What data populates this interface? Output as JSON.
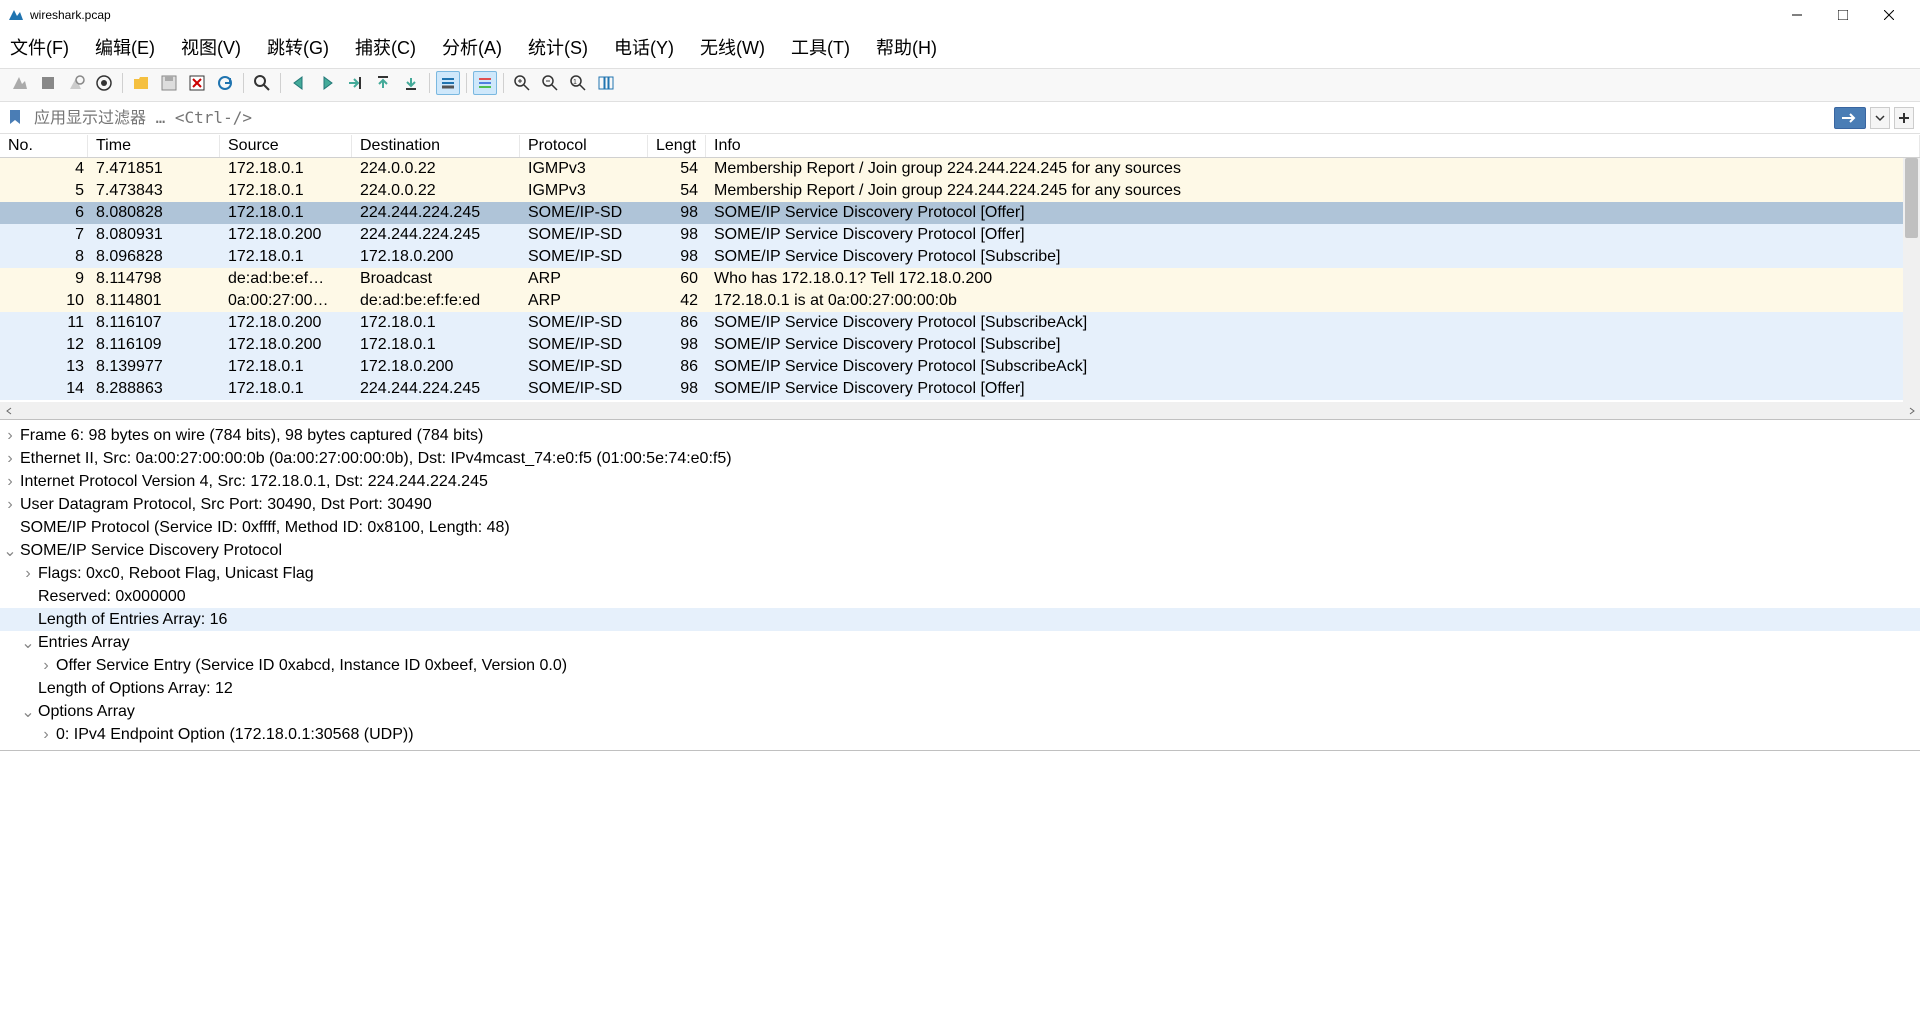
{
  "title": "wireshark.pcap",
  "menu": [
    "文件(F)",
    "编辑(E)",
    "视图(V)",
    "跳转(G)",
    "捕获(C)",
    "分析(A)",
    "统计(S)",
    "电话(Y)",
    "无线(W)",
    "工具(T)",
    "帮助(H)"
  ],
  "filter_placeholder": "应用显示过滤器 … <Ctrl-/>",
  "columns": [
    "No.",
    "Time",
    "Source",
    "Destination",
    "Protocol",
    "Lengt",
    "Info"
  ],
  "packets": [
    {
      "no": "4",
      "time": "7.471851",
      "src": "172.18.0.1",
      "dst": "224.0.0.22",
      "proto": "IGMPv3",
      "len": "54",
      "info": "Membership Report / Join group 224.244.224.245 for any sources",
      "cls": "bg-yellow"
    },
    {
      "no": "5",
      "time": "7.473843",
      "src": "172.18.0.1",
      "dst": "224.0.0.22",
      "proto": "IGMPv3",
      "len": "54",
      "info": "Membership Report / Join group 224.244.224.245 for any sources",
      "cls": "bg-yellow"
    },
    {
      "no": "6",
      "time": "8.080828",
      "src": "172.18.0.1",
      "dst": "224.244.224.245",
      "proto": "SOME/IP-SD",
      "len": "98",
      "info": "SOME/IP Service Discovery Protocol [Offer]",
      "cls": "bg-selected"
    },
    {
      "no": "7",
      "time": "8.080931",
      "src": "172.18.0.200",
      "dst": "224.244.224.245",
      "proto": "SOME/IP-SD",
      "len": "98",
      "info": "SOME/IP Service Discovery Protocol [Offer]",
      "cls": "bg-blue"
    },
    {
      "no": "8",
      "time": "8.096828",
      "src": "172.18.0.1",
      "dst": "172.18.0.200",
      "proto": "SOME/IP-SD",
      "len": "98",
      "info": "SOME/IP Service Discovery Protocol [Subscribe]",
      "cls": "bg-blue"
    },
    {
      "no": "9",
      "time": "8.114798",
      "src": "de:ad:be:ef…",
      "dst": "Broadcast",
      "proto": "ARP",
      "len": "60",
      "info": "Who has 172.18.0.1? Tell 172.18.0.200",
      "cls": "bg-yellow"
    },
    {
      "no": "10",
      "time": "8.114801",
      "src": "0a:00:27:00…",
      "dst": "de:ad:be:ef:fe:ed",
      "proto": "ARP",
      "len": "42",
      "info": "172.18.0.1 is at 0a:00:27:00:00:0b",
      "cls": "bg-yellow"
    },
    {
      "no": "11",
      "time": "8.116107",
      "src": "172.18.0.200",
      "dst": "172.18.0.1",
      "proto": "SOME/IP-SD",
      "len": "86",
      "info": "SOME/IP Service Discovery Protocol [SubscribeAck]",
      "cls": "bg-blue"
    },
    {
      "no": "12",
      "time": "8.116109",
      "src": "172.18.0.200",
      "dst": "172.18.0.1",
      "proto": "SOME/IP-SD",
      "len": "98",
      "info": "SOME/IP Service Discovery Protocol [Subscribe]",
      "cls": "bg-blue"
    },
    {
      "no": "13",
      "time": "8.139977",
      "src": "172.18.0.1",
      "dst": "172.18.0.200",
      "proto": "SOME/IP-SD",
      "len": "86",
      "info": "SOME/IP Service Discovery Protocol [SubscribeAck]",
      "cls": "bg-blue"
    },
    {
      "no": "14",
      "time": "8.288863",
      "src": "172.18.0.1",
      "dst": "224.244.224.245",
      "proto": "SOME/IP-SD",
      "len": "98",
      "info": "SOME/IP Service Discovery Protocol [Offer]",
      "cls": "bg-blue"
    }
  ],
  "details": [
    {
      "toggle": ">",
      "indent": 0,
      "text": "Frame 6: 98 bytes on wire (784 bits), 98 bytes captured (784 bits)"
    },
    {
      "toggle": ">",
      "indent": 0,
      "text": "Ethernet II, Src: 0a:00:27:00:00:0b (0a:00:27:00:00:0b), Dst: IPv4mcast_74:e0:f5 (01:00:5e:74:e0:f5)"
    },
    {
      "toggle": ">",
      "indent": 0,
      "text": "Internet Protocol Version 4, Src: 172.18.0.1, Dst: 224.244.224.245"
    },
    {
      "toggle": ">",
      "indent": 0,
      "text": "User Datagram Protocol, Src Port: 30490, Dst Port: 30490"
    },
    {
      "toggle": "",
      "indent": 0,
      "text": "SOME/IP Protocol (Service ID: 0xffff, Method ID: 0x8100, Length: 48)"
    },
    {
      "toggle": "v",
      "indent": 0,
      "text": "SOME/IP Service Discovery Protocol"
    },
    {
      "toggle": ">",
      "indent": 1,
      "text": "Flags: 0xc0, Reboot Flag, Unicast Flag"
    },
    {
      "toggle": "",
      "indent": 1,
      "text": "Reserved: 0x000000"
    },
    {
      "toggle": "",
      "indent": 1,
      "text": "Length of Entries Array: 16",
      "highlight": true
    },
    {
      "toggle": "v",
      "indent": 1,
      "text": "Entries Array"
    },
    {
      "toggle": ">",
      "indent": 2,
      "text": "Offer Service Entry (Service ID 0xabcd, Instance ID 0xbeef, Version 0.0)"
    },
    {
      "toggle": "",
      "indent": 1,
      "text": "Length of Options Array: 12"
    },
    {
      "toggle": "v",
      "indent": 1,
      "text": "Options Array"
    },
    {
      "toggle": ">",
      "indent": 2,
      "text": "0: IPv4 Endpoint Option (172.18.0.1:30568 (UDP))"
    }
  ]
}
